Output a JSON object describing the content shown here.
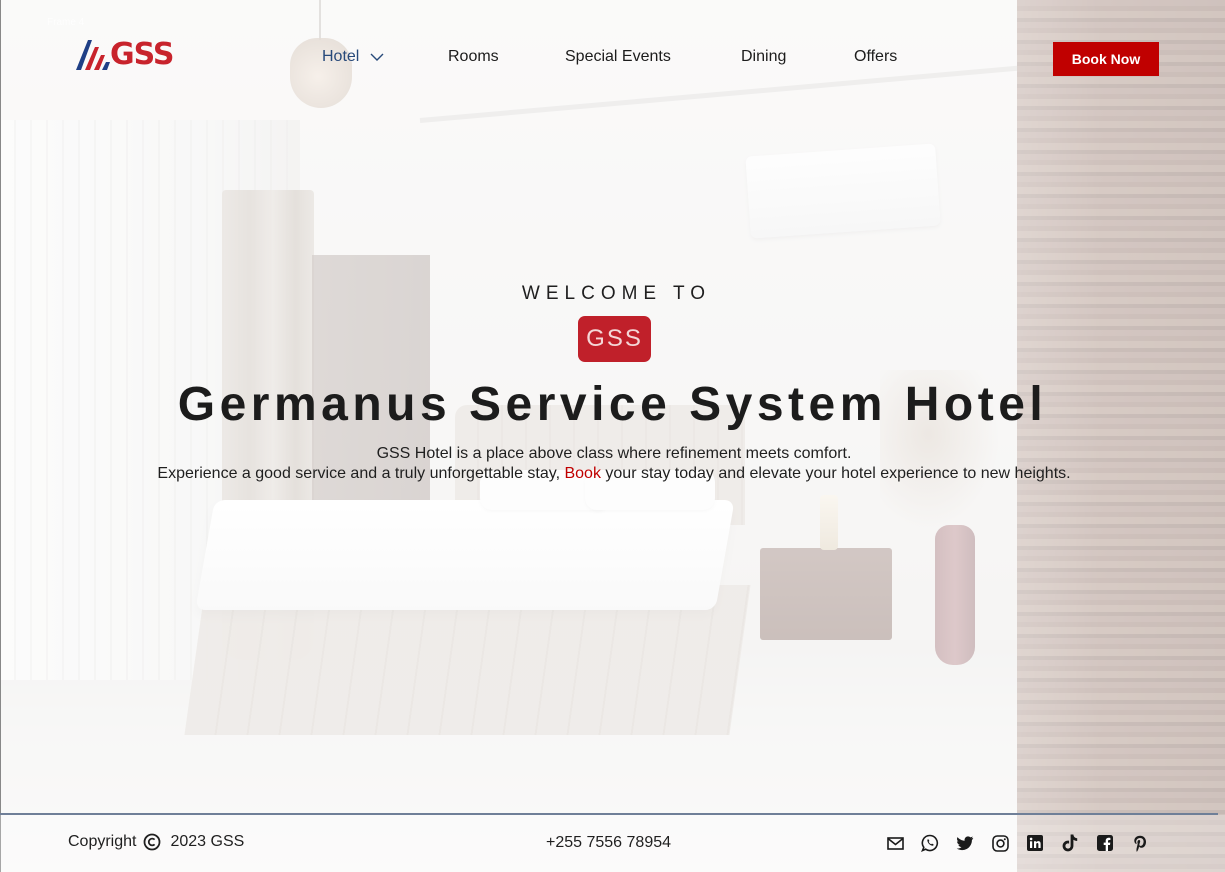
{
  "frame_label": "Frame 4",
  "brand": {
    "logo_text": "GSS"
  },
  "nav": {
    "items": [
      {
        "label": "Hotel",
        "active": true,
        "has_dropdown": true
      },
      {
        "label": "Rooms"
      },
      {
        "label": "Special Events"
      },
      {
        "label": "Dining"
      },
      {
        "label": "Offers"
      }
    ],
    "cta_label": "Book Now"
  },
  "hero": {
    "welcome": "WELCOME TO",
    "badge": "GSS",
    "title": "Germanus Service System Hotel",
    "line1": "GSS Hotel is a place above class where refinement meets comfort.",
    "line2_before": "Experience a good service and a truly unforgettable stay, ",
    "line2_link": "Book",
    "line2_after": " your stay today and elevate your hotel experience to new heights."
  },
  "footer": {
    "copyright_label": "Copyright",
    "copyright_year": "2023 GSS",
    "phone": "+255 7556 78954",
    "socials": [
      "mail-icon",
      "whatsapp-icon",
      "twitter-icon",
      "instagram-icon",
      "linkedin-icon",
      "tiktok-icon",
      "facebook-icon",
      "pinterest-icon"
    ]
  },
  "colors": {
    "accent_red": "#c00000",
    "badge_red": "#c0202a",
    "nav_active": "#27497a",
    "logo_blue": "#1f3f86"
  }
}
